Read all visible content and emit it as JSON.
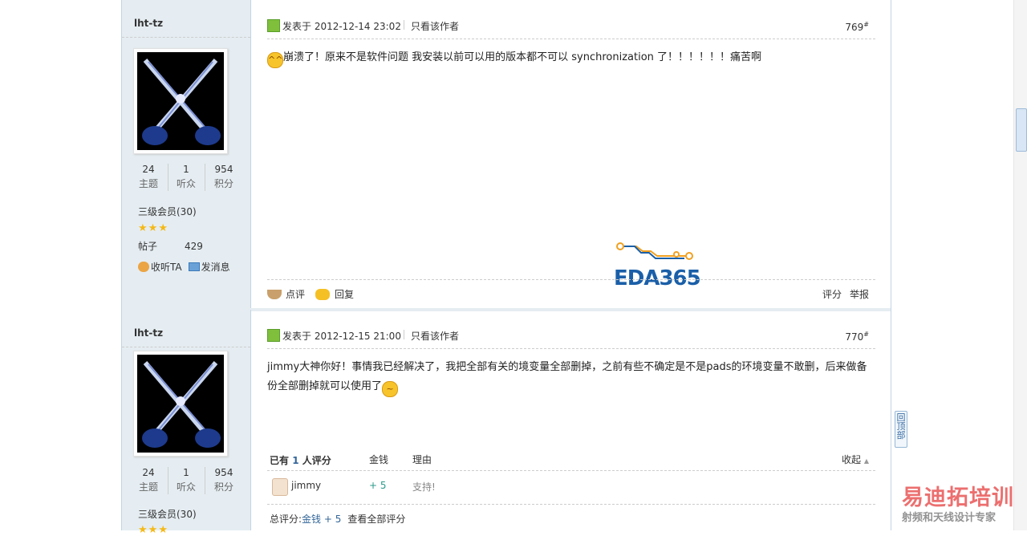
{
  "posts": [
    {
      "author": "lht-tz",
      "stats": [
        {
          "value": "24",
          "label": "主题"
        },
        {
          "value": "1",
          "label": "听众"
        },
        {
          "value": "954",
          "label": "积分"
        }
      ],
      "level": "三级会员(30)",
      "posts_label": "帖子",
      "posts_count": "429",
      "follow_label": "收听TA",
      "message_label": "发消息",
      "posted_at": "发表于 2012-12-14 23:02",
      "only_author": "只看该作者",
      "floor": "769",
      "floor_mark": "#",
      "content": "崩溃了！原来不是软件问题 我安装以前可以用的版本都不可以 synchronization 了！！！！！！痛苦啊",
      "comment_label": "点评",
      "reply_label": "回复",
      "rate_label": "评分",
      "report_label": "举报"
    },
    {
      "author": "lht-tz",
      "stats": [
        {
          "value": "24",
          "label": "主题"
        },
        {
          "value": "1",
          "label": "听众"
        },
        {
          "value": "954",
          "label": "积分"
        }
      ],
      "level": "三级会员(30)",
      "posted_at": "发表于 2012-12-15 21:00",
      "only_author": "只看该作者",
      "floor": "770",
      "floor_mark": "#",
      "content": "jimmy大神你好！事情我已经解决了，我把全部有关的境变量全部删掉，之前有些不确定是不是pads的环境变量不敢删，后来做备份全部删掉就可以使用了",
      "rating": {
        "prefix": "已有",
        "count": "1",
        "suffix": "人评分",
        "col_money": "金钱",
        "col_reason": "理由",
        "fold_label": "收起",
        "rows": [
          {
            "user": "jimmy",
            "value": "+ 5",
            "reason": "支持!"
          }
        ],
        "total_label": "总评分:",
        "total_value": "金钱 + 5",
        "view_all": "查看全部评分"
      }
    }
  ],
  "logo_text": "EDA365",
  "back_to_top": "回顶部",
  "watermark": {
    "title": "易迪拓培训",
    "subtitle": "射频和天线设计专家"
  },
  "colors": {
    "sidebar_bg": "#e5edf2",
    "border": "#c2d5e3",
    "link_blue": "#336699",
    "rating_green": "#2c9a8a",
    "logo_blue": "#1a5fa8",
    "watermark_red": "#e84c4c"
  }
}
